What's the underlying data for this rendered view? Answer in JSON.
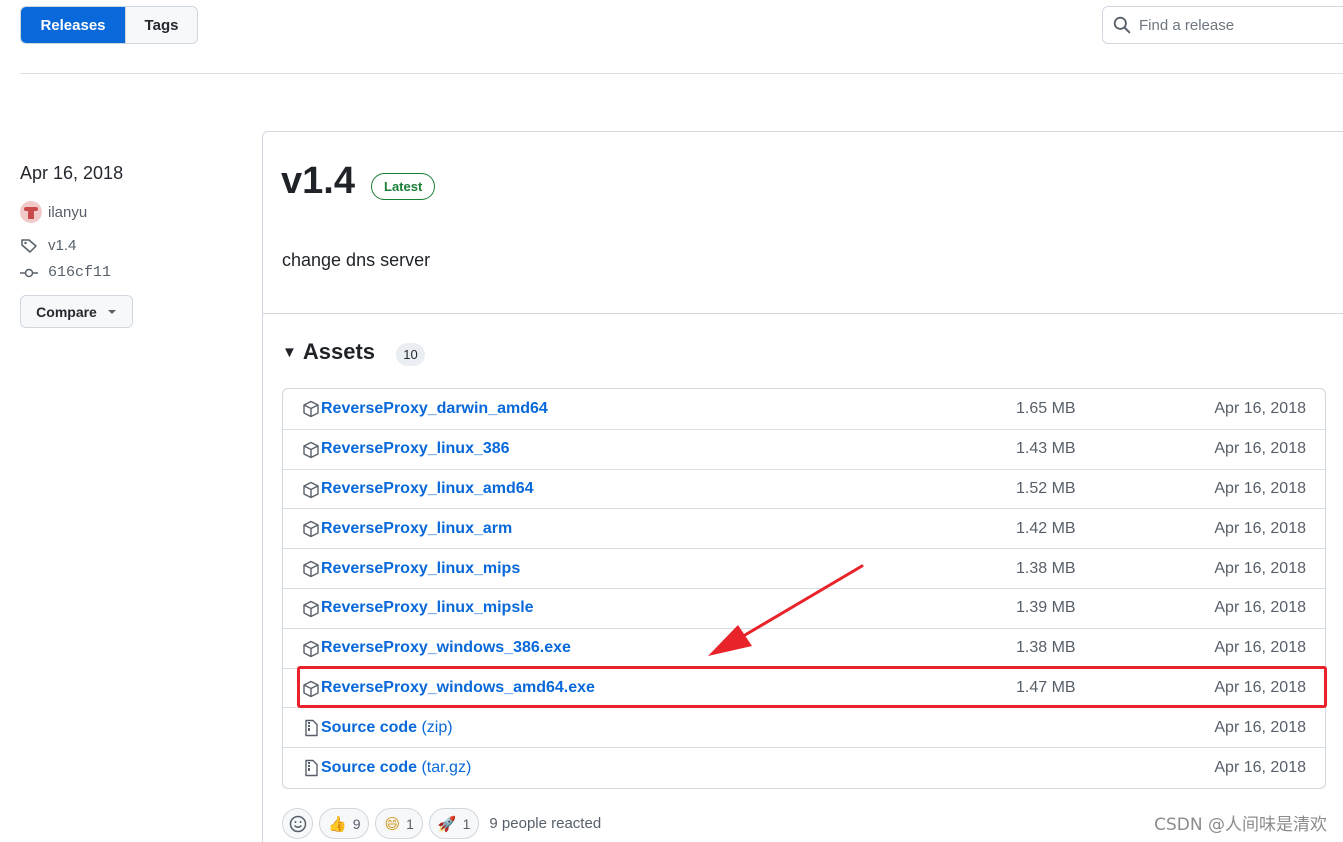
{
  "tabs": {
    "releases_label": "Releases",
    "tags_label": "Tags"
  },
  "search": {
    "placeholder": "Find a release"
  },
  "meta": {
    "date": "Apr 16, 2018",
    "author": "ilanyu",
    "tag": "v1.4",
    "commit": "616cf11",
    "compare_label": "Compare"
  },
  "release": {
    "title": "v1.4",
    "latest_badge": "Latest",
    "body": "change dns server"
  },
  "assets": {
    "heading": "Assets",
    "count": "10",
    "items": [
      {
        "name": "ReverseProxy_darwin_amd64",
        "suffix": "",
        "size": "1.65 MB",
        "date": "Apr 16, 2018",
        "icon": "package-icon"
      },
      {
        "name": "ReverseProxy_linux_386",
        "suffix": "",
        "size": "1.43 MB",
        "date": "Apr 16, 2018",
        "icon": "package-icon"
      },
      {
        "name": "ReverseProxy_linux_amd64",
        "suffix": "",
        "size": "1.52 MB",
        "date": "Apr 16, 2018",
        "icon": "package-icon"
      },
      {
        "name": "ReverseProxy_linux_arm",
        "suffix": "",
        "size": "1.42 MB",
        "date": "Apr 16, 2018",
        "icon": "package-icon"
      },
      {
        "name": "ReverseProxy_linux_mips",
        "suffix": "",
        "size": "1.38 MB",
        "date": "Apr 16, 2018",
        "icon": "package-icon"
      },
      {
        "name": "ReverseProxy_linux_mipsle",
        "suffix": "",
        "size": "1.39 MB",
        "date": "Apr 16, 2018",
        "icon": "package-icon"
      },
      {
        "name": "ReverseProxy_windows_386.exe",
        "suffix": "",
        "size": "1.38 MB",
        "date": "Apr 16, 2018",
        "icon": "package-icon"
      },
      {
        "name": "ReverseProxy_windows_amd64.exe",
        "suffix": "",
        "size": "1.47 MB",
        "date": "Apr 16, 2018",
        "icon": "package-icon"
      },
      {
        "name": "Source code",
        "suffix": " (zip)",
        "size": "",
        "date": "Apr 16, 2018",
        "icon": "file-zip-icon"
      },
      {
        "name": "Source code",
        "suffix": " (tar.gz)",
        "size": "",
        "date": "Apr 16, 2018",
        "icon": "file-zip-icon"
      }
    ]
  },
  "reactions": {
    "thumbs_up": "9",
    "laugh": "1",
    "rocket": "1",
    "summary": "9 people reacted"
  },
  "watermark": "CSDN @人间味是清欢",
  "colors": {
    "accent": "#0969da",
    "latest": "#1a7f37",
    "annotation": "#e8232a"
  }
}
